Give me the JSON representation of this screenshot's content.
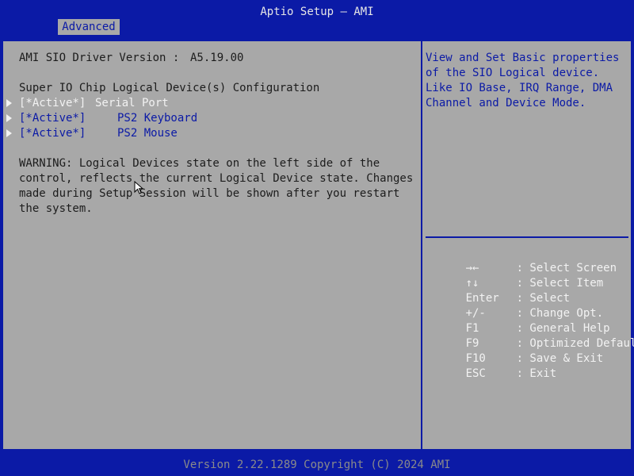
{
  "app": {
    "title": "Aptio Setup – AMI"
  },
  "tabs": [
    {
      "label": "Advanced"
    }
  ],
  "main": {
    "driver_label": "AMI SIO Driver Version :",
    "driver_value": "A5.19.00",
    "section_heading": "Super IO Chip Logical Device(s) Configuration",
    "devices": [
      {
        "state": "[*Active*]",
        "name": "Serial Port"
      },
      {
        "state": "[*Active*]",
        "name": "PS2 Keyboard"
      },
      {
        "state": "[*Active*]",
        "name": "PS2 Mouse"
      }
    ],
    "warning_lines": [
      "WARNING: Logical Devices state on the left side of the",
      "control, reflects the current Logical Device state. Changes",
      "made during Setup Session will be shown after you restart",
      "the system."
    ]
  },
  "help": {
    "text": "View and Set Basic properties\nof the SIO Logical device.\nLike IO Base, IRQ Range, DMA\nChannel and Device Mode."
  },
  "keys": [
    {
      "key": "→←",
      "desc": ": Select Screen",
      "icon": "left-right-arrows-icon"
    },
    {
      "key": "↑↓",
      "desc": ": Select Item",
      "icon": "up-down-arrows-icon"
    },
    {
      "key": "Enter",
      "desc": ": Select"
    },
    {
      "key": "+/-",
      "desc": ": Change Opt."
    },
    {
      "key": "F1",
      "desc": ": General Help"
    },
    {
      "key": "F9",
      "desc": ": Optimized Defaults"
    },
    {
      "key": "F10",
      "desc": ": Save & Exit"
    },
    {
      "key": "ESC",
      "desc": ": Exit"
    }
  ],
  "footer": {
    "version": "Version 2.22.1289 Copyright (C) 2024 AMI"
  },
  "colors": {
    "frame_blue": "#0b1aa6",
    "panel_gray": "#a8a8a8",
    "text_dark": "#1c1c1c",
    "text_white": "#f2f2f2"
  }
}
